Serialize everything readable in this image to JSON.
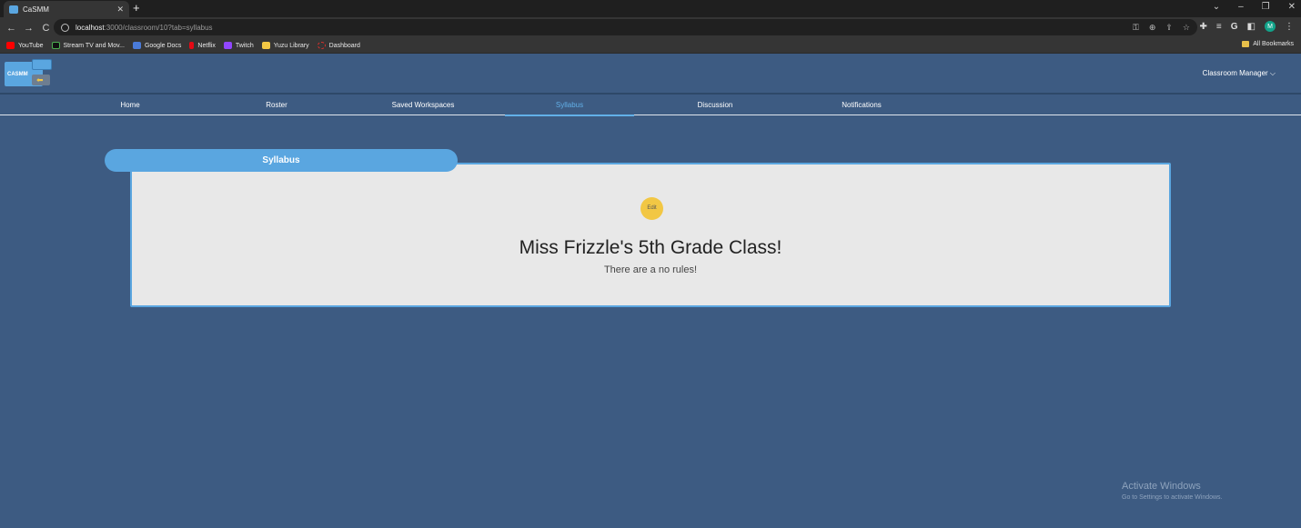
{
  "browser": {
    "tab_title": "CaSMM",
    "tab_close": "✕",
    "new_tab": "+",
    "window_controls": [
      "⌄",
      "–",
      "❐",
      "✕"
    ],
    "nav": {
      "back": "←",
      "forward": "→",
      "reload": "C"
    },
    "url_host": "localhost",
    "url_path": ":3000/classroom/10?tab=syllabus",
    "profile_initial": "M",
    "bookmarks": [
      {
        "label": "YouTube",
        "color": "#ff0000"
      },
      {
        "label": "Stream TV and Mov...",
        "color": "#111111"
      },
      {
        "label": "Google Docs",
        "color": "#4a7bd9"
      },
      {
        "label": "Netflix",
        "color": "#e50914"
      },
      {
        "label": "Twitch",
        "color": "#9146ff"
      },
      {
        "label": "Yuzu Library",
        "color": "#f2c744"
      },
      {
        "label": "Dashboard",
        "color": "#d9302c"
      }
    ],
    "all_bookmarks": "All Bookmarks"
  },
  "app": {
    "logo_text": "CASMM",
    "manager_menu": "Classroom Manager ⌵",
    "nav": [
      {
        "label": "Home",
        "active": false
      },
      {
        "label": "Roster",
        "active": false
      },
      {
        "label": "Saved Workspaces",
        "active": false
      },
      {
        "label": "Syllabus",
        "active": true
      },
      {
        "label": "Discussion",
        "active": false
      },
      {
        "label": "Notifications",
        "active": false
      }
    ]
  },
  "syllabus": {
    "tab_label": "Syllabus",
    "edit_label": "Edit",
    "title": "Miss Frizzle's 5th Grade Class!",
    "body": "There are a no rules!"
  },
  "watermark": {
    "title": "Activate Windows",
    "subtitle": "Go to Settings to activate Windows."
  },
  "colors": {
    "page_bg": "#3d5b82",
    "accent": "#5aa6e0",
    "edit_button": "#f2c744",
    "card_bg": "#e8e8e8"
  }
}
